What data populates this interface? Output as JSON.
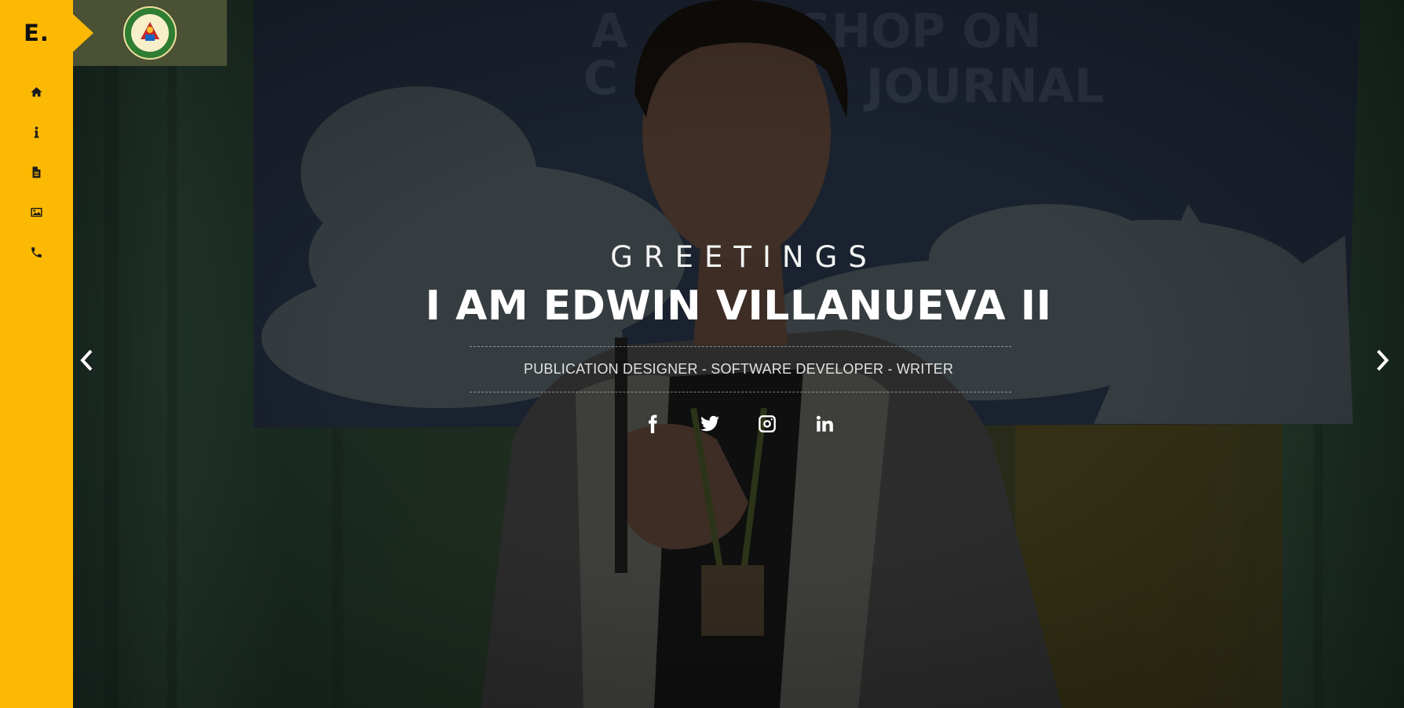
{
  "sidebar": {
    "brand": "E.",
    "nav": [
      {
        "icon": "home-icon",
        "label": "Home"
      },
      {
        "icon": "info-icon",
        "label": "About"
      },
      {
        "icon": "document-icon",
        "label": "Resume"
      },
      {
        "icon": "image-icon",
        "label": "Gallery"
      },
      {
        "icon": "phone-icon",
        "label": "Contact"
      }
    ]
  },
  "hero": {
    "greeting": "GREETINGS",
    "name": "I AM EDWIN VILLANUEVA II",
    "subtitle": "PUBLICATION DESIGNER - SOFTWARE DEVELOPER - WRITER",
    "socials": [
      "facebook-icon",
      "twitter-icon",
      "instagram-icon",
      "linkedin-icon"
    ]
  },
  "colors": {
    "sidebar": "#fbb903",
    "logo_box": "#4a5134",
    "text": "#ffffff"
  }
}
